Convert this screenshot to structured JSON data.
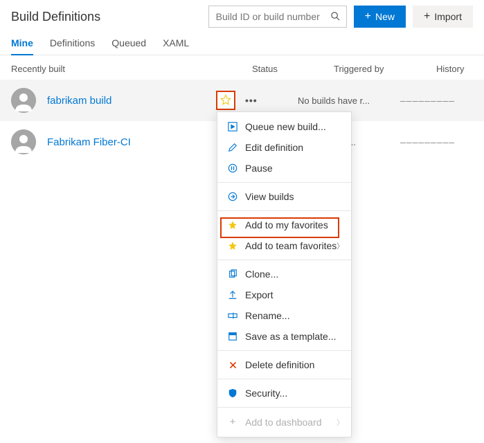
{
  "header": {
    "title": "Build Definitions",
    "search_placeholder": "Build ID or build number",
    "new_label": "New",
    "import_label": "Import"
  },
  "tabs": [
    {
      "id": "mine",
      "label": "Mine",
      "active": true
    },
    {
      "id": "definitions",
      "label": "Definitions",
      "active": false
    },
    {
      "id": "queued",
      "label": "Queued",
      "active": false
    },
    {
      "id": "xaml",
      "label": "XAML",
      "active": false
    }
  ],
  "columns": {
    "name": "Recently built",
    "status": "Status",
    "triggered": "Triggered by",
    "history": "History"
  },
  "rows": [
    {
      "name": "fabrikam build",
      "triggered": "No builds have r...",
      "hovered": true,
      "history": "–––––––––"
    },
    {
      "name": "Fabrikam Fiber-CI",
      "triggered": "builds have r...",
      "hovered": false,
      "history": "–––––––––"
    }
  ],
  "menu": {
    "queue": "Queue new build...",
    "edit": "Edit definition",
    "pause": "Pause",
    "view": "View builds",
    "fav_my": "Add to my favorites",
    "fav_team": "Add to team favorites",
    "clone": "Clone...",
    "export": "Export",
    "rename": "Rename...",
    "template": "Save as a template...",
    "delete": "Delete definition",
    "security": "Security...",
    "dashboard": "Add to dashboard"
  }
}
